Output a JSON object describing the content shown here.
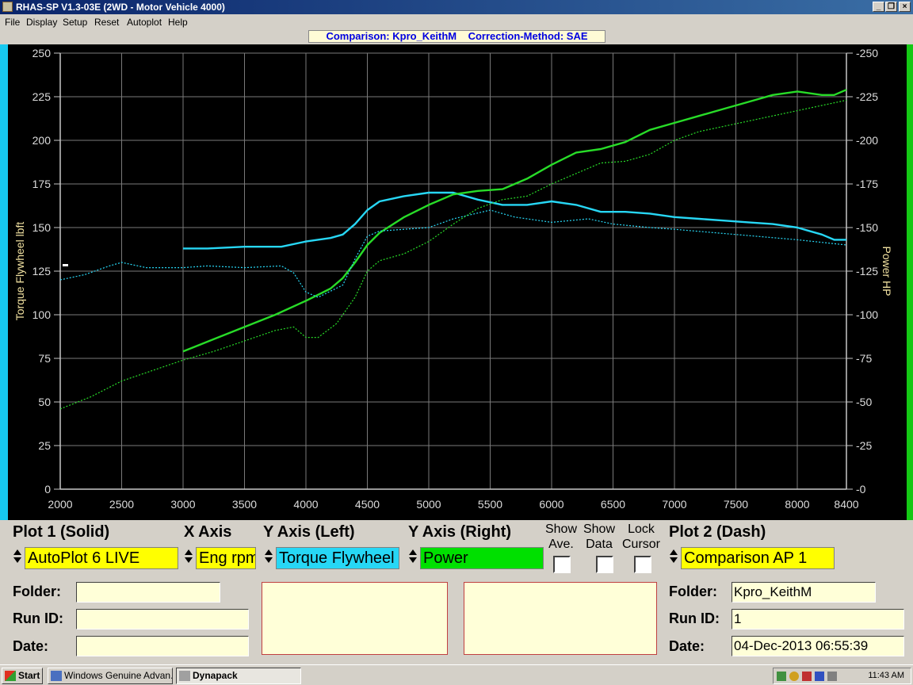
{
  "window": {
    "title": "RHAS-SP V1.3-03E  (2WD - Motor Vehicle 4000)",
    "min_label": "_",
    "max_label": "❐",
    "close_label": "×"
  },
  "menu": [
    {
      "label": "File"
    },
    {
      "label": "Display"
    },
    {
      "label": "Setup"
    },
    {
      "label": "Reset"
    },
    {
      "label": "Autoplot"
    },
    {
      "label": "Help"
    }
  ],
  "comparison_bar": "Comparison: Kpro_KeithM    Correction-Method: SAE",
  "colors": {
    "torque": "#27d7f5",
    "power": "#28dc28",
    "left_strip": "#17c9f0",
    "right_strip": "#14c814",
    "yellow": "#ffff00"
  },
  "chart_data": {
    "type": "line",
    "xlabel": "",
    "ylabel": "Torque Flywheel lbft",
    "y2label": "Power HP",
    "xlim": [
      2000,
      8400
    ],
    "ylim": [
      0,
      250
    ],
    "y2lim": [
      0,
      250
    ],
    "x_ticks": [
      2000,
      2500,
      3000,
      3500,
      4000,
      4500,
      5000,
      5500,
      6000,
      6500,
      7000,
      7500,
      8000,
      8400
    ],
    "y_ticks": [
      0,
      25,
      50,
      75,
      100,
      125,
      150,
      175,
      200,
      225,
      250
    ],
    "grid": true,
    "series": [
      {
        "style": "solid",
        "axis": "left",
        "color_key": "torque",
        "points": [
          [
            3000,
            138
          ],
          [
            3200,
            138
          ],
          [
            3500,
            139
          ],
          [
            3800,
            139
          ],
          [
            4000,
            142
          ],
          [
            4200,
            144
          ],
          [
            4300,
            146
          ],
          [
            4400,
            152
          ],
          [
            4500,
            160
          ],
          [
            4600,
            165
          ],
          [
            4800,
            168
          ],
          [
            5000,
            170
          ],
          [
            5200,
            170
          ],
          [
            5400,
            166
          ],
          [
            5600,
            163
          ],
          [
            5800,
            163
          ],
          [
            6000,
            165
          ],
          [
            6200,
            163
          ],
          [
            6400,
            159
          ],
          [
            6600,
            159
          ],
          [
            6800,
            158
          ],
          [
            7000,
            156
          ],
          [
            7200,
            155
          ],
          [
            7400,
            154
          ],
          [
            7600,
            153
          ],
          [
            7800,
            152
          ],
          [
            8000,
            150
          ],
          [
            8200,
            146
          ],
          [
            8300,
            143
          ],
          [
            8400,
            143
          ]
        ]
      },
      {
        "style": "solid",
        "axis": "right",
        "color_key": "power",
        "points": [
          [
            3000,
            79
          ],
          [
            3250,
            86
          ],
          [
            3500,
            93
          ],
          [
            3750,
            100
          ],
          [
            4000,
            108
          ],
          [
            4200,
            115
          ],
          [
            4300,
            121
          ],
          [
            4400,
            130
          ],
          [
            4500,
            140
          ],
          [
            4600,
            147
          ],
          [
            4800,
            156
          ],
          [
            5000,
            163
          ],
          [
            5200,
            169
          ],
          [
            5400,
            171
          ],
          [
            5600,
            172
          ],
          [
            5800,
            178
          ],
          [
            6000,
            186
          ],
          [
            6200,
            193
          ],
          [
            6400,
            195
          ],
          [
            6600,
            199
          ],
          [
            6800,
            206
          ],
          [
            7000,
            210
          ],
          [
            7200,
            214
          ],
          [
            7400,
            218
          ],
          [
            7600,
            222
          ],
          [
            7800,
            226
          ],
          [
            8000,
            228
          ],
          [
            8200,
            226
          ],
          [
            8300,
            226
          ],
          [
            8400,
            229
          ]
        ]
      },
      {
        "style": "dashed",
        "axis": "left",
        "color_key": "torque",
        "points": [
          [
            2000,
            120
          ],
          [
            2200,
            123
          ],
          [
            2400,
            128
          ],
          [
            2500,
            130
          ],
          [
            2700,
            127
          ],
          [
            3000,
            127
          ],
          [
            3200,
            128
          ],
          [
            3500,
            127
          ],
          [
            3800,
            128
          ],
          [
            3900,
            124
          ],
          [
            4000,
            113
          ],
          [
            4100,
            110
          ],
          [
            4300,
            117
          ],
          [
            4400,
            132
          ],
          [
            4500,
            145
          ],
          [
            4600,
            148
          ],
          [
            5000,
            150
          ],
          [
            5200,
            155
          ],
          [
            5500,
            160
          ],
          [
            5700,
            156
          ],
          [
            6000,
            153
          ],
          [
            6300,
            155
          ],
          [
            6500,
            152
          ],
          [
            6800,
            150
          ],
          [
            7000,
            149
          ],
          [
            7500,
            146
          ],
          [
            8000,
            143
          ],
          [
            8400,
            140
          ]
        ]
      },
      {
        "style": "dashed",
        "axis": "right",
        "color_key": "power",
        "points": [
          [
            2000,
            46
          ],
          [
            2250,
            53
          ],
          [
            2500,
            62
          ],
          [
            2750,
            68
          ],
          [
            3000,
            74
          ],
          [
            3250,
            79
          ],
          [
            3500,
            85
          ],
          [
            3750,
            91
          ],
          [
            3900,
            93
          ],
          [
            4000,
            87
          ],
          [
            4100,
            87
          ],
          [
            4250,
            95
          ],
          [
            4400,
            110
          ],
          [
            4500,
            125
          ],
          [
            4600,
            131
          ],
          [
            4800,
            135
          ],
          [
            5000,
            142
          ],
          [
            5200,
            152
          ],
          [
            5400,
            161
          ],
          [
            5600,
            166
          ],
          [
            5800,
            168
          ],
          [
            6000,
            175
          ],
          [
            6200,
            181
          ],
          [
            6400,
            187
          ],
          [
            6600,
            188
          ],
          [
            6800,
            192
          ],
          [
            7000,
            200
          ],
          [
            7200,
            205
          ],
          [
            7400,
            208
          ],
          [
            7600,
            211
          ],
          [
            7800,
            214
          ],
          [
            8000,
            217
          ],
          [
            8200,
            220
          ],
          [
            8400,
            223
          ]
        ]
      }
    ]
  },
  "controls": {
    "plot1_header": "Plot 1 (Solid)",
    "xaxis_header": "X Axis",
    "yleft_header": "Y Axis (Left)",
    "yright_header": "Y Axis (Right)",
    "show_ave_label": "Show Ave.",
    "show_data_label": "Show Data",
    "lock_cursor_label": "Lock Cursor",
    "plot2_header": "Plot 2 (Dash)",
    "plot1_value": "AutoPlot 6 LIVE",
    "xaxis_value": "Eng rpm",
    "yleft_value": "Torque Flywheel",
    "yright_value": "Power",
    "plot2_value": "Comparison AP 1",
    "plot1": {
      "folder_label": "Folder:",
      "runid_label": "Run ID:",
      "date_label": "Date:",
      "folder": "",
      "runid": "",
      "date": ""
    },
    "plot2": {
      "folder_label": "Folder:",
      "runid_label": "Run ID:",
      "date_label": "Date:",
      "folder": "Kpro_KeithM",
      "runid": "1",
      "date": "04-Dec-2013  06:55:39"
    }
  },
  "taskbar": {
    "start": "Start",
    "tasks": [
      {
        "label": "Windows Genuine Advan..."
      },
      {
        "label": "Dynapack"
      }
    ],
    "clock": "11:43 AM"
  }
}
